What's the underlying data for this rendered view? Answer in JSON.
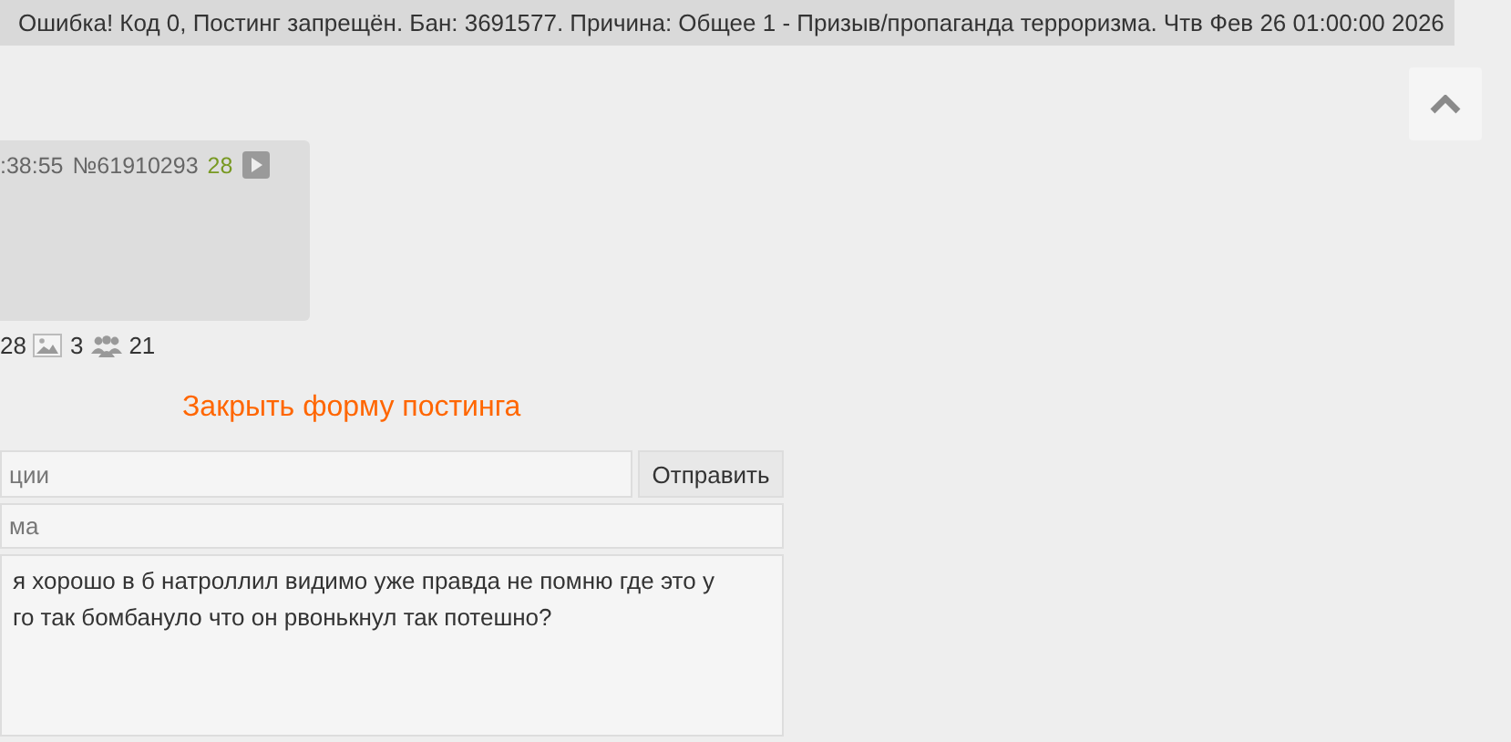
{
  "error_bar": {
    "text": "Ошибка! Код 0, Постинг запрещён. Бан: 3691577. Причина: Общее 1 - Призыв/пропаганда терроризма. Чтв Фев 26 01:00:00 2026"
  },
  "post": {
    "time": ":38:55",
    "number": "№61910293",
    "replies": "28"
  },
  "thread_stats": {
    "posts": "28",
    "images": "3",
    "posters": "21"
  },
  "close_form_link": "Закрыть форму постинга",
  "form": {
    "subject": {
      "placeholder": "ции"
    },
    "submit": "Отправить",
    "name": {
      "placeholder": "ма"
    },
    "comment": {
      "value": "я хорошо в б натроллил видимо уже правда не помню где это у\nго так бомбануло что он рвонькнул так потешно?"
    }
  }
}
